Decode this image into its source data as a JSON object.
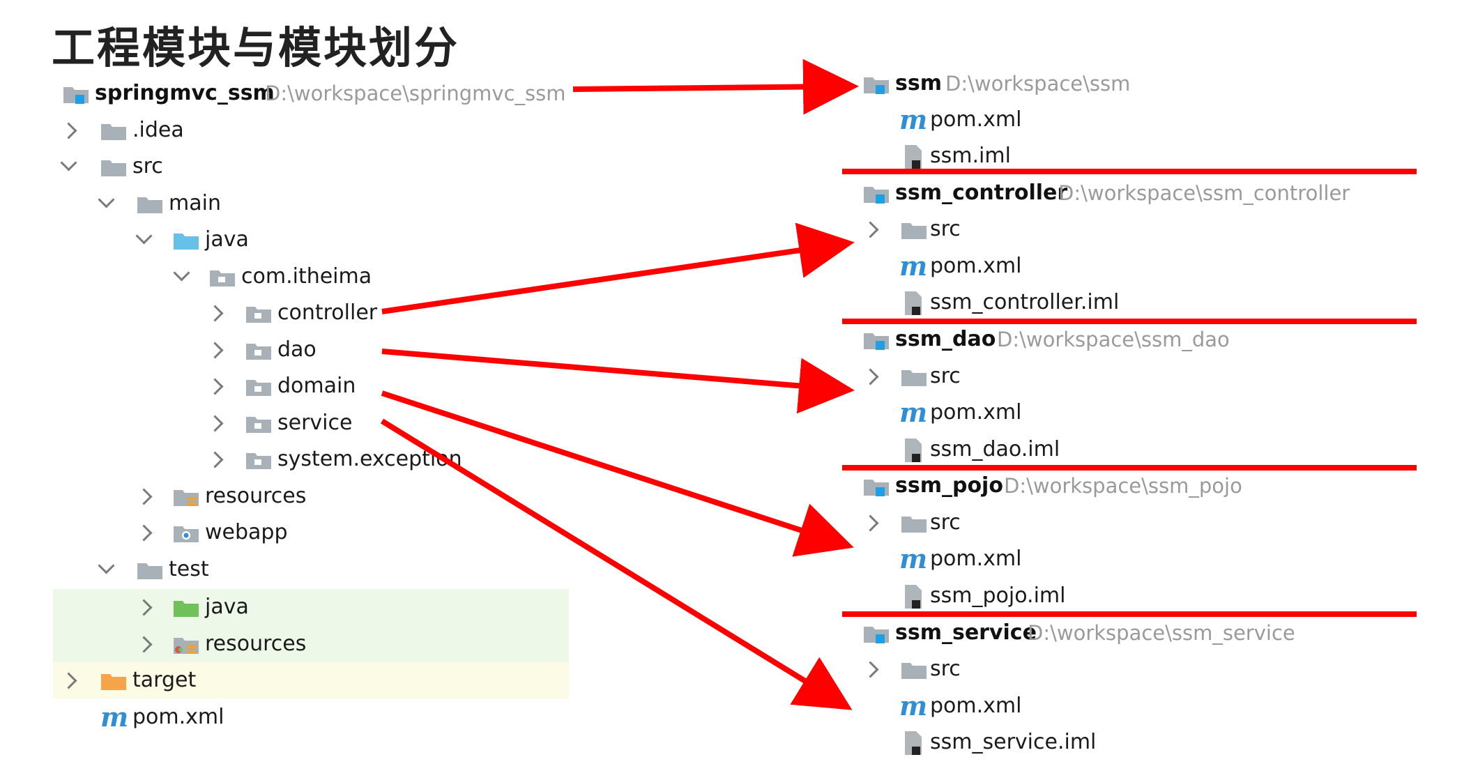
{
  "title": "工程模块与模块划分",
  "left_tree": [
    {
      "label": "springmvc_ssm",
      "path": "D:\\workspace\\springmvc_ssm"
    },
    {
      "label": ".idea"
    },
    {
      "label": "src"
    },
    {
      "label": "main"
    },
    {
      "label": "java"
    },
    {
      "label": "com.itheima"
    },
    {
      "label": "controller"
    },
    {
      "label": "dao"
    },
    {
      "label": "domain"
    },
    {
      "label": "service"
    },
    {
      "label": "system.exception"
    },
    {
      "label": "resources"
    },
    {
      "label": "webapp"
    },
    {
      "label": "test"
    },
    {
      "label": "java"
    },
    {
      "label": "resources"
    },
    {
      "label": "target"
    },
    {
      "label": "pom.xml"
    }
  ],
  "modules": [
    {
      "name": "ssm",
      "path": "D:\\workspace\\ssm",
      "files": [
        "pom.xml",
        "ssm.iml"
      ]
    },
    {
      "name": "ssm_controller",
      "path": "D:\\workspace\\ssm_controller",
      "files": [
        "src",
        "pom.xml",
        "ssm_controller.iml"
      ]
    },
    {
      "name": "ssm_dao",
      "path": "D:\\workspace\\ssm_dao",
      "files": [
        "src",
        "pom.xml",
        "ssm_dao.iml"
      ]
    },
    {
      "name": "ssm_pojo",
      "path": "D:\\workspace\\ssm_pojo",
      "files": [
        "src",
        "pom.xml",
        "ssm_pojo.iml"
      ]
    },
    {
      "name": "ssm_service",
      "path": "D:\\workspace\\ssm_service",
      "files": [
        "src",
        "pom.xml",
        "ssm_service.iml"
      ]
    }
  ],
  "arrows": [
    {
      "from": "springmvc_ssm",
      "to": "ssm"
    },
    {
      "from": "controller",
      "to": "ssm_controller"
    },
    {
      "from": "dao",
      "to": "ssm_dao"
    },
    {
      "from": "domain",
      "to": "ssm_pojo"
    },
    {
      "from": "service",
      "to": "ssm_service"
    }
  ],
  "colors": {
    "arrow": "#ff0000",
    "folder": "#a9b1b8",
    "source_folder": "#67c0e8",
    "test_folder": "#6fc25a",
    "excluded_folder": "#f5a44a",
    "maven_icon": "#2f8fd6",
    "path_text": "#9a9a9a",
    "test_band": "#eef8e9",
    "excluded_band": "#fbfbe6"
  },
  "icons": [
    "chevron-right-icon",
    "chevron-down-icon",
    "module-folder-icon",
    "folder-icon",
    "package-icon",
    "source-folder-icon",
    "test-folder-icon",
    "resources-folder-icon",
    "web-folder-icon",
    "excluded-folder-icon",
    "maven-icon",
    "iml-file-icon"
  ]
}
